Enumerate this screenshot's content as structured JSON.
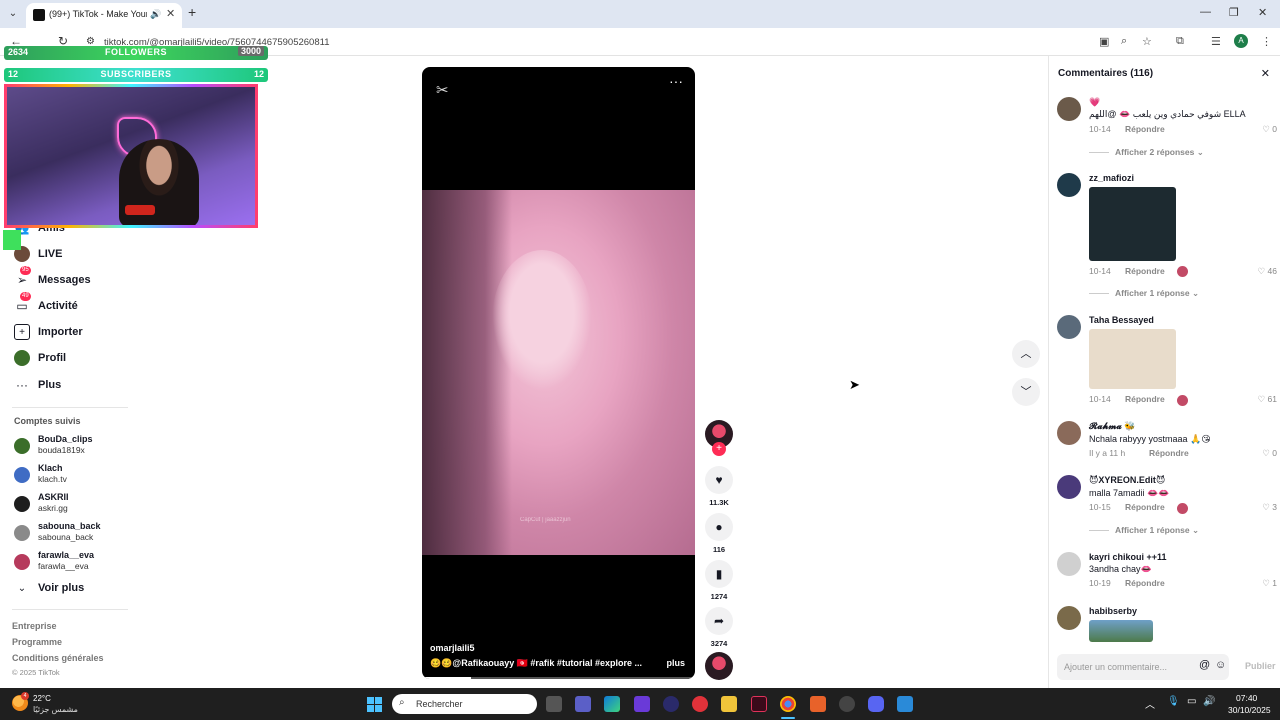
{
  "browser": {
    "tab_title": "(99+) TikTok - Make Your Day",
    "url": "tiktok.com/@omarjlaili5/video/7560744675905260811",
    "profile_initial": "A"
  },
  "overlay": {
    "followers_current": "2634",
    "followers_label": "FOLLOWERS",
    "followers_goal": "3000",
    "followers_progress": 0.878,
    "subs_current": "12",
    "subs_label": "SUBSCRIBERS",
    "subs_goal": "12",
    "subs_progress": 1.0
  },
  "sidebar": {
    "items": [
      {
        "label": "Amis",
        "icon": "friends-icon"
      },
      {
        "label": "LIVE",
        "icon": "live-icon"
      },
      {
        "label": "Messages",
        "icon": "messages-icon",
        "badge": "95"
      },
      {
        "label": "Activité",
        "icon": "activity-icon",
        "badge": "49"
      },
      {
        "label": "Importer",
        "icon": "upload-icon"
      },
      {
        "label": "Profil",
        "icon": "profile-icon"
      },
      {
        "label": "Plus",
        "icon": "more-icon"
      }
    ],
    "following_title": "Comptes suivis",
    "following": [
      {
        "name": "BouDa_clips",
        "handle": "bouda1819x",
        "color": "#3b6e2a"
      },
      {
        "name": "Klach",
        "handle": "klach.tv",
        "color": "#3f6cc4"
      },
      {
        "name": "ASKRII",
        "handle": "askri.gg",
        "color": "#1e1e1e"
      },
      {
        "name": "sabouna_back",
        "handle": "sabouna_back",
        "color": "#8a8a8a"
      },
      {
        "name": "farawla__eva",
        "handle": "farawla__eva",
        "color": "#b63a5c"
      }
    ],
    "see_more": "Voir plus",
    "footer": [
      "Entreprise",
      "Programme",
      "Conditions générales"
    ],
    "copyright": "© 2025 TikTok"
  },
  "video": {
    "author": "omarjlaili5",
    "caption": "🥴🥴@Rafikaouayy 🇹🇳  #rafik  #tutorial  #explore  ...",
    "more_label": "plus",
    "watermark": "CapCut | jaaazzjun",
    "progress": 0.18
  },
  "actions": {
    "likes": "11.3K",
    "comments": "116",
    "saves": "1274",
    "shares": "3274"
  },
  "comments_panel": {
    "title": "Commentaires (116)",
    "items": [
      {
        "user": "💗",
        "text": "شوفي حمادي وين يلعب 👄 @اللهم ELLA",
        "date": "10-14",
        "reply": "Répondre",
        "likes": "0",
        "replies": "Afficher 2 réponses",
        "avatar": "#6b5a4a"
      },
      {
        "user": "zz_mafiozi",
        "text": "",
        "date": "10-14",
        "reply": "Répondre",
        "likes": "46",
        "replies": "Afficher 1 réponse",
        "avatar": "#1f3a4a",
        "creator_liked": true
      },
      {
        "user": "Taha Bessayed",
        "text": "",
        "date": "10-14",
        "reply": "Répondre",
        "likes": "61",
        "avatar": "#5a6a7a",
        "creator_liked": true
      },
      {
        "user": "𝓡𝓪𝓱𝓶𝓪 🐝",
        "text": "Nchala rabyyy yostmaaa 🙏😘",
        "date": "Il y a 11 h",
        "reply": "Répondre",
        "likes": "0",
        "avatar": "#8a6a5a"
      },
      {
        "user": "😈XYREON.Edit😈",
        "text": "malla 7amadii 👄👄",
        "date": "10-15",
        "reply": "Répondre",
        "likes": "3",
        "replies": "Afficher 1 réponse",
        "avatar": "#4a3a7a",
        "creator_liked": true
      },
      {
        "user": "kayri chikoui ++11",
        "text": "3andha chay👄",
        "date": "10-19",
        "reply": "Répondre",
        "likes": "1",
        "avatar": "#d0d0d0"
      },
      {
        "user": "habibserby",
        "text": "",
        "date": "",
        "reply": "",
        "likes": "",
        "avatar": "#7a6a4a"
      }
    ],
    "input_placeholder": "Ajouter un commentaire...",
    "post_label": "Publier"
  },
  "taskbar": {
    "temperature": "22°C",
    "weather_desc": "مشمس جزئيًا",
    "weather_badge": "4",
    "search_label": "Rechercher",
    "time": "07:40",
    "date": "30/10/2025"
  },
  "colors": {
    "tiktok_red": "#fe2c55",
    "taskbar_bg": "#1f1f1f",
    "chrome_tab_bg": "#dfe6f2"
  }
}
